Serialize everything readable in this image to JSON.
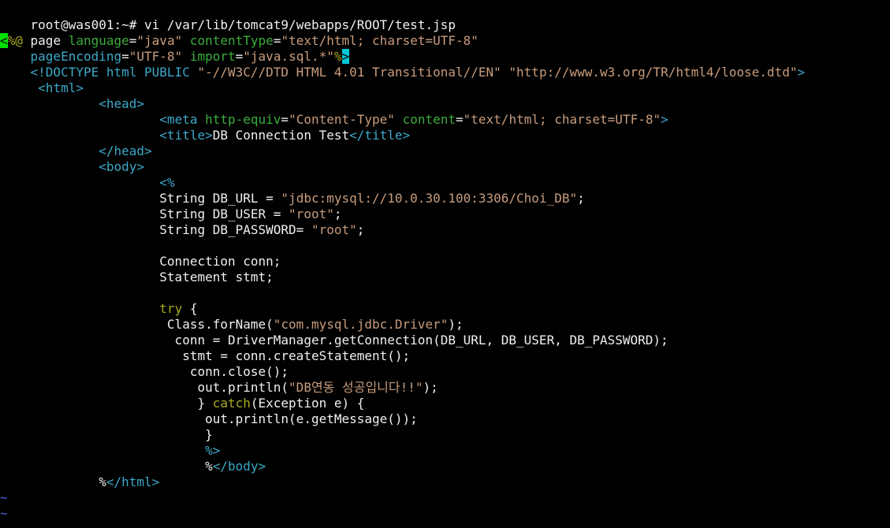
{
  "terminal": {
    "prompt": "root@was001:~# ",
    "command": "vi /var/lib/tomcat9/webapps/ROOT/test.jsp",
    "tilde": "~"
  },
  "colors": {
    "default": "#f0f0f0",
    "delimiter": "#a8a820",
    "keyword": "#a8a820",
    "attribute": "#3cac3c",
    "string": "#c89c7c",
    "tag": "#3ca8c8",
    "cursor_green": "#00e000",
    "cursor_cyan": "#00c8d8",
    "tilde": "#4060d8"
  },
  "lines": [
    [
      [
        "█cursor",
        ""
      ]
    ],
    [
      [
        "cursor",
        "<"
      ],
      [
        "delimiter",
        "%@"
      ],
      [
        "default",
        " page "
      ],
      [
        "attribute",
        "language"
      ],
      [
        "default",
        "="
      ],
      [
        "string",
        "\"java\""
      ],
      [
        "default",
        " "
      ],
      [
        "attribute",
        "contentType"
      ],
      [
        "default",
        "="
      ],
      [
        "string",
        "\"text/html; charset=UTF-8\""
      ]
    ],
    [
      [
        "default",
        "    "
      ],
      [
        "tag",
        "pageEncoding"
      ],
      [
        "default",
        "="
      ],
      [
        "string",
        "\"UTF-8\""
      ],
      [
        "default",
        " "
      ],
      [
        "attribute",
        "import"
      ],
      [
        "default",
        "="
      ],
      [
        "string",
        "\"java.sql.*\""
      ],
      [
        "delimiter",
        "%"
      ],
      [
        "cursor2",
        ">"
      ]
    ],
    [
      [
        "default",
        "    "
      ],
      [
        "tag",
        "<!DOCTYPE html PUBLIC "
      ],
      [
        "string",
        "\"-//W3C//DTD HTML 4.01 Transitional//EN\""
      ],
      [
        "default",
        " "
      ],
      [
        "string",
        "\"http://www.w3.org/TR/html4/loose.dtd\""
      ],
      [
        "tag",
        ">"
      ]
    ],
    [
      [
        "default",
        "     "
      ],
      [
        "tag",
        "<html>"
      ]
    ],
    [
      [
        "default",
        "             "
      ],
      [
        "tag",
        "<head>"
      ]
    ],
    [
      [
        "default",
        "                     "
      ],
      [
        "tag",
        "<meta "
      ],
      [
        "attribute",
        "http-equiv"
      ],
      [
        "default",
        "="
      ],
      [
        "string",
        "\"Content-Type\""
      ],
      [
        "default",
        " "
      ],
      [
        "attribute",
        "content"
      ],
      [
        "default",
        "="
      ],
      [
        "string",
        "\"text/html; charset=UTF-8\""
      ],
      [
        "tag",
        ">"
      ]
    ],
    [
      [
        "default",
        "                     "
      ],
      [
        "tag",
        "<title>"
      ],
      [
        "default",
        "DB Connection Test"
      ],
      [
        "tag",
        "</title>"
      ]
    ],
    [
      [
        "default",
        "             "
      ],
      [
        "tag",
        "</head>"
      ]
    ],
    [
      [
        "default",
        "             "
      ],
      [
        "tag",
        "<body>"
      ]
    ],
    [
      [
        "default",
        "                     "
      ],
      [
        "tag",
        "<%"
      ]
    ],
    [
      [
        "default",
        "                     String DB_URL = "
      ],
      [
        "string",
        "\"jdbc:mysql://10.0.30.100:3306/Choi_DB\""
      ],
      [
        "default",
        ";"
      ]
    ],
    [
      [
        "default",
        "                     String DB_USER = "
      ],
      [
        "string",
        "\"root\""
      ],
      [
        "default",
        ";"
      ]
    ],
    [
      [
        "default",
        "                     String DB_PASSWORD= "
      ],
      [
        "string",
        "\"root\""
      ],
      [
        "default",
        ";"
      ]
    ],
    [
      [
        "default",
        ""
      ]
    ],
    [
      [
        "default",
        "                     Connection conn;"
      ]
    ],
    [
      [
        "default",
        "                     Statement stmt;"
      ]
    ],
    [
      [
        "default",
        ""
      ]
    ],
    [
      [
        "default",
        "                     "
      ],
      [
        "keyword",
        "try"
      ],
      [
        "default",
        " {"
      ]
    ],
    [
      [
        "default",
        "                      Class.forName("
      ],
      [
        "string",
        "\"com.mysql.jdbc.Driver\""
      ],
      [
        "default",
        ");"
      ]
    ],
    [
      [
        "default",
        "                       conn = DriverManager.getConnection(DB_URL, DB_USER, DB_PASSWORD);"
      ]
    ],
    [
      [
        "default",
        "                        stmt = conn.createStatement();"
      ]
    ],
    [
      [
        "default",
        "                         conn.close();"
      ]
    ],
    [
      [
        "default",
        "                          out.println("
      ],
      [
        "string",
        "\"DB연동 성공입니다!!\""
      ],
      [
        "default",
        ");"
      ]
    ],
    [
      [
        "default",
        "                          } "
      ],
      [
        "keyword",
        "catch"
      ],
      [
        "default",
        "(Exception e) {"
      ]
    ],
    [
      [
        "default",
        "                           out.println(e.getMessage());"
      ]
    ],
    [
      [
        "default",
        "                           }"
      ]
    ],
    [
      [
        "default",
        "                           "
      ],
      [
        "tag",
        "%>"
      ]
    ],
    [
      [
        "default",
        "                           %"
      ],
      [
        "tag",
        "</body>"
      ]
    ],
    [
      [
        "default",
        "             %"
      ],
      [
        "tag",
        "</html>"
      ]
    ]
  ]
}
